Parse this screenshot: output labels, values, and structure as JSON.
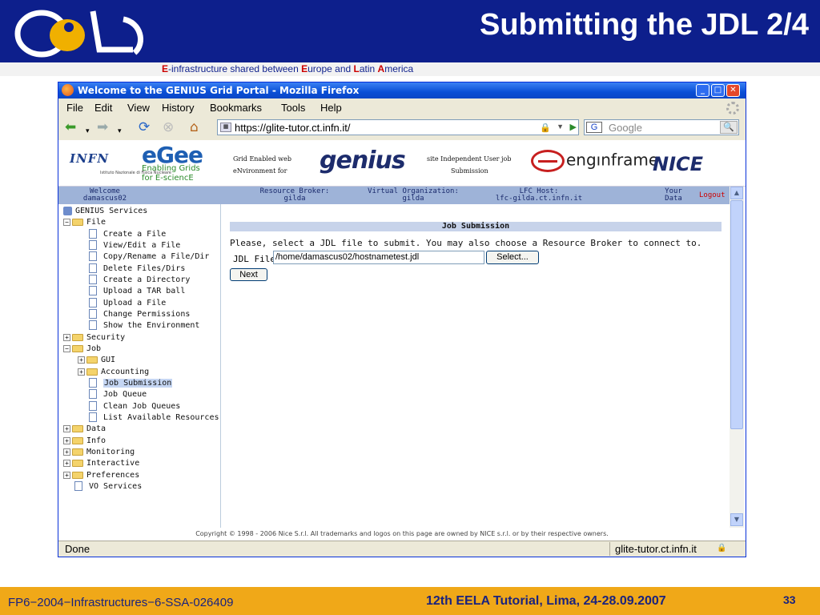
{
  "slide": {
    "title": "Submitting the JDL 2/4",
    "subtitle_parts": [
      "E",
      "-infrastructure shared between ",
      "E",
      "urope and ",
      "L",
      "atin ",
      "A",
      "merica"
    ],
    "footer_left": "FP6−2004−Infrastructures−6-SSA-026409",
    "footer_center": "12th EELA Tutorial, Lima, 24-28.09.2007",
    "page_number": "33",
    "colors": {
      "header_bg": "#0d1f8c",
      "footer_bg": "#f0a818",
      "accent_red": "#cc0000"
    }
  },
  "browser": {
    "window_title": "Welcome to the GENIUS Grid Portal - Mozilla Firefox",
    "menu": [
      "File",
      "Edit",
      "View",
      "History",
      "Bookmarks",
      "Tools",
      "Help"
    ],
    "url": "https://glite-tutor.ct.infn.it/",
    "search_placeholder": "Google",
    "search_engine_icon": "G",
    "status_text": "Done",
    "status_host": "glite-tutor.ct.infn.it"
  },
  "portal": {
    "logos": {
      "infn": "INFN",
      "infn_sub": "Istituto Nazionale di Fisica Nucleare",
      "egee": "eGee",
      "egee_tag_1": "Enabling Grids",
      "egee_tag_2": "for E-sciencE",
      "genius_left_1": "Grid Enabled web",
      "genius_left_2": "eNvironment for",
      "genius": "genius",
      "genius_right_1": "site Independent User job",
      "genius_right_2": "Submission",
      "enginframe": "engınframe",
      "nice": "NICE"
    },
    "info_bar": {
      "welcome_label": "Welcome",
      "welcome_user": "damascus02",
      "rb_label": "Resource Broker:",
      "rb_value": "gilda",
      "vo_label": "Virtual Organization:",
      "vo_value": "gilda",
      "lfc_label": "LFC Host:",
      "lfc_value": "lfc-gilda.ct.infn.it",
      "your_label": "Your",
      "data_label": "Data",
      "logout": "Logout"
    },
    "tree": {
      "root": "GENIUS Services",
      "file": "File",
      "file_items": [
        "Create a File",
        "View/Edit a File",
        "Copy/Rename a File/Dir",
        "Delete Files/Dirs",
        "Create a Directory",
        "Upload a TAR ball",
        "Upload a File",
        "Change Permissions",
        "Show the Environment"
      ],
      "security": "Security",
      "job": "Job",
      "job_gui": "GUI",
      "job_accounting": "Accounting",
      "job_items": [
        "Job Submission",
        "Job Queue",
        "Clean Job Queues",
        "List Available Resources"
      ],
      "data": "Data",
      "info": "Info",
      "monitoring": "Monitoring",
      "interactive": "Interactive",
      "preferences": "Preferences",
      "vo_services": "VO Services"
    },
    "job_submission": {
      "header": "Job Submission",
      "instructions": "Please, select a JDL file to submit. You may also choose a Resource Broker to connect to.",
      "jdl_label": "JDL File",
      "jdl_value": "/home/damascus02/hostnametest.jdl",
      "select_label": "Select...",
      "next_label": "Next"
    },
    "copyright": "Copyright © 1998 - 2006 Nice S.r.l. All trademarks and logos on this page are owned by NICE s.r.l. or by their respective owners."
  }
}
